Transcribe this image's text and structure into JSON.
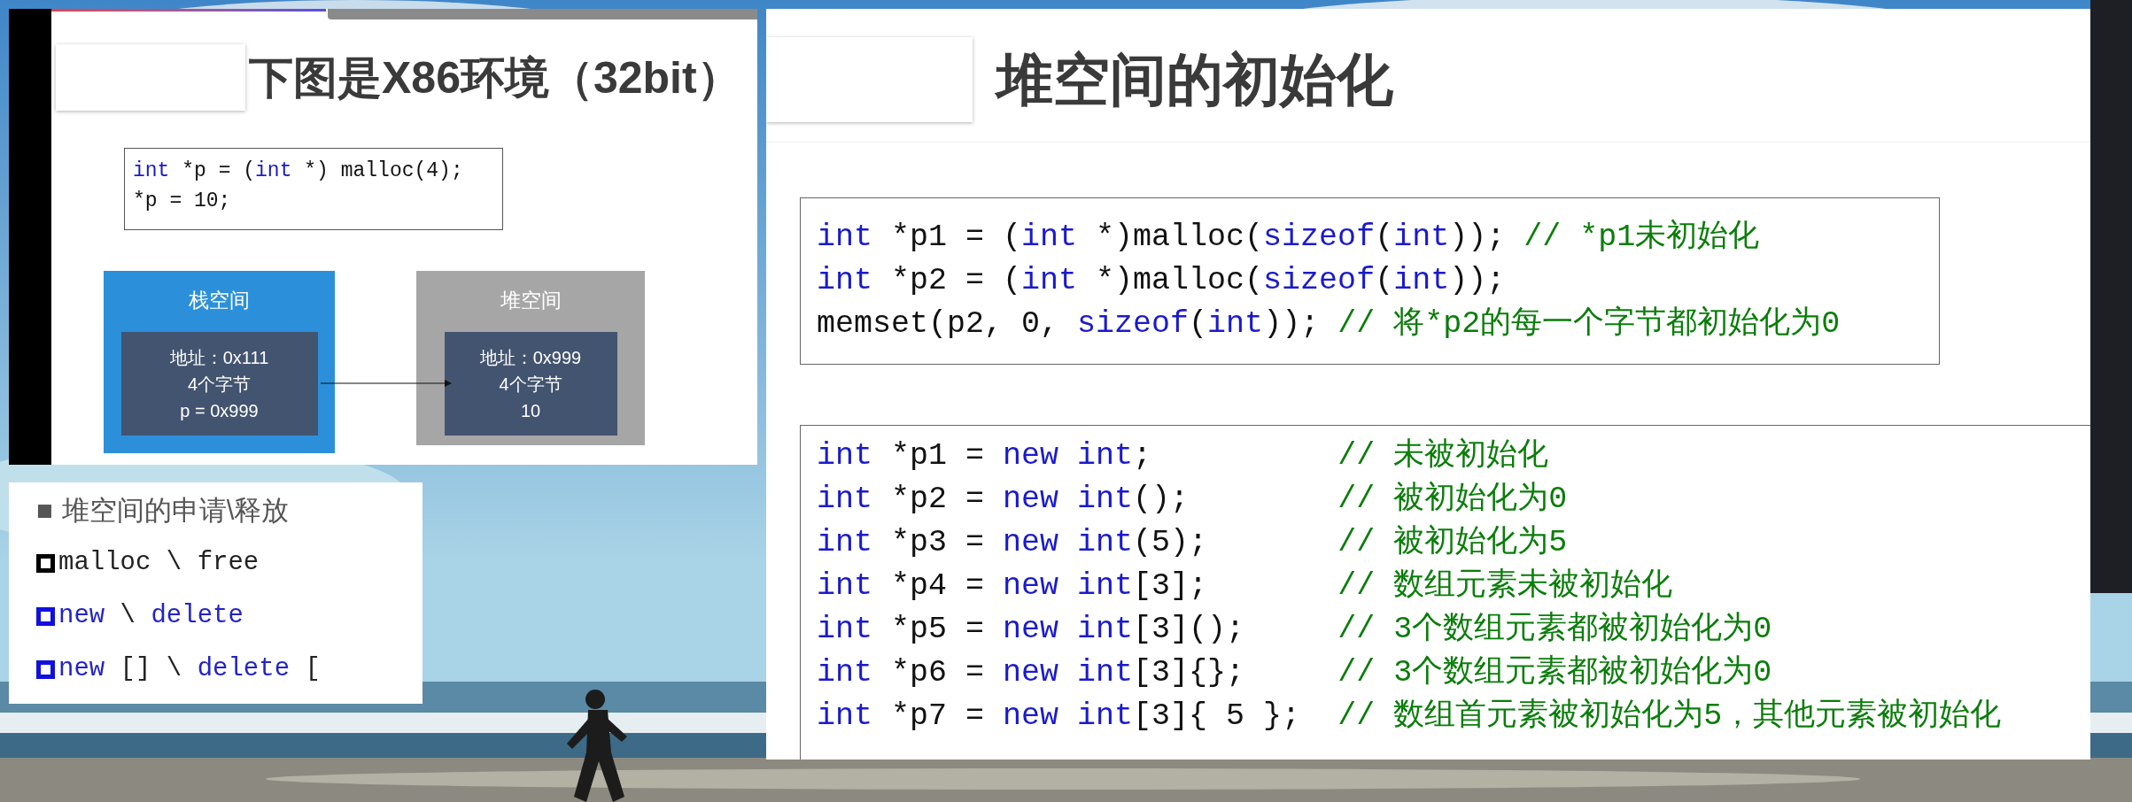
{
  "left_slide": {
    "title": "下图是X86环境（32bit）",
    "code": [
      [
        {
          "text": "int",
          "kind": "kw"
        },
        {
          "text": " *p = (",
          "kind": "tx"
        },
        {
          "text": "int",
          "kind": "kw"
        },
        {
          "text": " *) malloc(4);",
          "kind": "tx"
        }
      ],
      [
        {
          "text": "*p = 10;",
          "kind": "tx"
        }
      ]
    ],
    "diagram": {
      "stack": {
        "label": "栈空间",
        "lines": [
          "地址：0x111",
          "4个字节",
          "p = 0x999"
        ]
      },
      "heap": {
        "label": "堆空间",
        "lines": [
          "地址：0x999",
          "4个字节",
          "10"
        ]
      }
    }
  },
  "outline_panel": {
    "marker": "■",
    "heading": "堆空间的申请\\释放",
    "items": [
      [
        {
          "text": "malloc \\ free",
          "kind": "tx"
        }
      ],
      [
        {
          "text": "new",
          "kind": "kw"
        },
        {
          "text": " \\ ",
          "kind": "tx"
        },
        {
          "text": "delete",
          "kind": "kw"
        }
      ],
      [
        {
          "text": "new",
          "kind": "kw"
        },
        {
          "text": " [] \\ ",
          "kind": "tx"
        },
        {
          "text": "delete",
          "kind": "kw"
        },
        {
          "text": " [",
          "kind": "tx"
        }
      ]
    ]
  },
  "right_slide": {
    "title": "堆空间的初始化",
    "code_blocks": [
      [
        [
          {
            "text": "int",
            "kind": "kw"
          },
          {
            "text": " *p1 = (",
            "kind": "tx"
          },
          {
            "text": "int",
            "kind": "kw"
          },
          {
            "text": " *)malloc(",
            "kind": "tx"
          },
          {
            "text": "sizeof",
            "kind": "kw"
          },
          {
            "text": "(",
            "kind": "tx"
          },
          {
            "text": "int",
            "kind": "kw"
          },
          {
            "text": ")); ",
            "kind": "tx"
          },
          {
            "text": "// *p1未初始化",
            "kind": "cm"
          }
        ],
        [
          {
            "text": "int",
            "kind": "kw"
          },
          {
            "text": " *p2 = (",
            "kind": "tx"
          },
          {
            "text": "int",
            "kind": "kw"
          },
          {
            "text": " *)malloc(",
            "kind": "tx"
          },
          {
            "text": "sizeof",
            "kind": "kw"
          },
          {
            "text": "(",
            "kind": "tx"
          },
          {
            "text": "int",
            "kind": "kw"
          },
          {
            "text": "));",
            "kind": "tx"
          }
        ],
        [
          {
            "text": "memset(p2, 0, ",
            "kind": "tx"
          },
          {
            "text": "sizeof",
            "kind": "kw"
          },
          {
            "text": "(",
            "kind": "tx"
          },
          {
            "text": "int",
            "kind": "kw"
          },
          {
            "text": ")); ",
            "kind": "tx"
          },
          {
            "text": "// 将*p2的每一个字节都初始化为0",
            "kind": "cm"
          }
        ]
      ],
      [
        [
          {
            "text": "int",
            "kind": "kw"
          },
          {
            "text": " *p1 = ",
            "kind": "tx"
          },
          {
            "text": "new int",
            "kind": "kw"
          },
          {
            "text": ";          ",
            "kind": "tx"
          },
          {
            "text": "// 未被初始化",
            "kind": "cm"
          }
        ],
        [
          {
            "text": "int",
            "kind": "kw"
          },
          {
            "text": " *p2 = ",
            "kind": "tx"
          },
          {
            "text": "new int",
            "kind": "kw"
          },
          {
            "text": "();        ",
            "kind": "tx"
          },
          {
            "text": "// 被初始化为0",
            "kind": "cm"
          }
        ],
        [
          {
            "text": "int",
            "kind": "kw"
          },
          {
            "text": " *p3 = ",
            "kind": "tx"
          },
          {
            "text": "new int",
            "kind": "kw"
          },
          {
            "text": "(5);       ",
            "kind": "tx"
          },
          {
            "text": "// 被初始化为5",
            "kind": "cm"
          }
        ],
        [
          {
            "text": "int",
            "kind": "kw"
          },
          {
            "text": " *p4 = ",
            "kind": "tx"
          },
          {
            "text": "new int",
            "kind": "kw"
          },
          {
            "text": "[3];       ",
            "kind": "tx"
          },
          {
            "text": "// 数组元素未被初始化",
            "kind": "cm"
          }
        ],
        [
          {
            "text": "int",
            "kind": "kw"
          },
          {
            "text": " *p5 = ",
            "kind": "tx"
          },
          {
            "text": "new int",
            "kind": "kw"
          },
          {
            "text": "[3]();     ",
            "kind": "tx"
          },
          {
            "text": "// 3个数组元素都被初始化为0",
            "kind": "cm"
          }
        ],
        [
          {
            "text": "int",
            "kind": "kw"
          },
          {
            "text": " *p6 = ",
            "kind": "tx"
          },
          {
            "text": "new int",
            "kind": "kw"
          },
          {
            "text": "[3]{};     ",
            "kind": "tx"
          },
          {
            "text": "// 3个数组元素都被初始化为0",
            "kind": "cm"
          }
        ],
        [
          {
            "text": "int",
            "kind": "kw"
          },
          {
            "text": " *p7 = ",
            "kind": "tx"
          },
          {
            "text": "new int",
            "kind": "kw"
          },
          {
            "text": "[3]{ 5 };  ",
            "kind": "tx"
          },
          {
            "text": "// 数组首元素被初始化为5，其他元素被初始化",
            "kind": "cm"
          }
        ]
      ]
    ]
  }
}
